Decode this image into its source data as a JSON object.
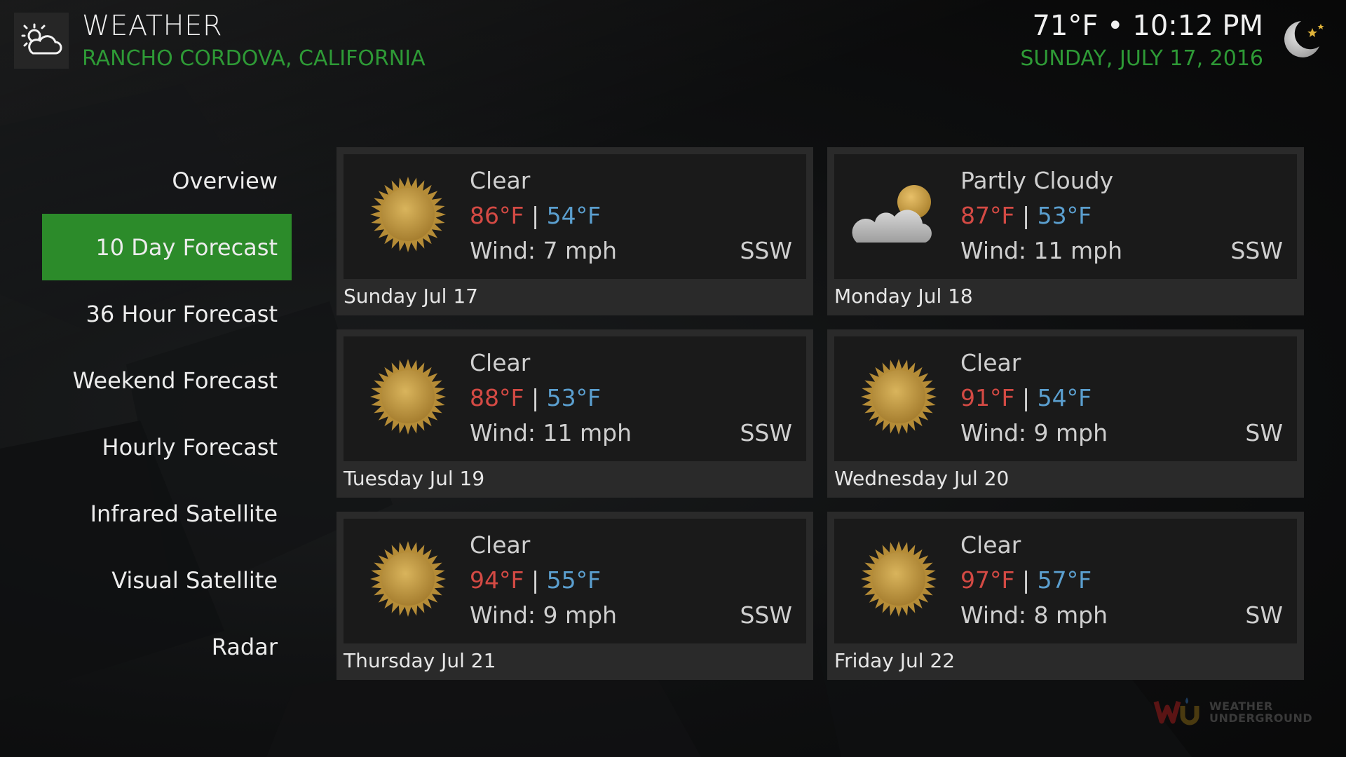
{
  "header": {
    "app_icon": "weather-app-icon",
    "title": "WEATHER",
    "location": "RANCHO CORDOVA, CALIFORNIA",
    "time_text": "71°F • 10:12 PM",
    "date_text": "SUNDAY, JULY 17, 2016",
    "condition_icon": "moon-stars-icon"
  },
  "sidebar": {
    "items": [
      {
        "label": "Overview",
        "active": false
      },
      {
        "label": "10 Day Forecast",
        "active": true
      },
      {
        "label": "36 Hour Forecast",
        "active": false
      },
      {
        "label": "Weekend Forecast",
        "active": false
      },
      {
        "label": "Hourly Forecast",
        "active": false
      },
      {
        "label": "Infrared Satellite",
        "active": false
      },
      {
        "label": "Visual Satellite",
        "active": false
      },
      {
        "label": "Radar",
        "active": false
      }
    ]
  },
  "forecast": [
    {
      "icon": "sun-icon",
      "condition": "Clear",
      "high": "86°F",
      "sep": "|",
      "low": "54°F",
      "wind": "Wind: 7 mph",
      "direction": "SSW",
      "day": "Sunday Jul 17"
    },
    {
      "icon": "partly-cloudy-icon",
      "condition": "Partly Cloudy",
      "high": "87°F",
      "sep": "|",
      "low": "53°F",
      "wind": "Wind: 11 mph",
      "direction": "SSW",
      "day": "Monday Jul 18"
    },
    {
      "icon": "sun-icon",
      "condition": "Clear",
      "high": "88°F",
      "sep": "|",
      "low": "53°F",
      "wind": "Wind: 11 mph",
      "direction": "SSW",
      "day": "Tuesday Jul 19"
    },
    {
      "icon": "sun-icon",
      "condition": "Clear",
      "high": "91°F",
      "sep": "|",
      "low": "54°F",
      "wind": "Wind: 9 mph",
      "direction": "SW",
      "day": "Wednesday Jul 20"
    },
    {
      "icon": "sun-icon",
      "condition": "Clear",
      "high": "94°F",
      "sep": "|",
      "low": "55°F",
      "wind": "Wind: 9 mph",
      "direction": "SSW",
      "day": "Thursday Jul 21"
    },
    {
      "icon": "sun-icon",
      "condition": "Clear",
      "high": "97°F",
      "sep": "|",
      "low": "57°F",
      "wind": "Wind: 8 mph",
      "direction": "SW",
      "day": "Friday Jul 22"
    }
  ],
  "footer": {
    "logo_text": "WEATHER\nUNDERGROUND"
  },
  "colors": {
    "accent_green": "#2c8b2a",
    "location_green": "#2e9a36",
    "high_temp": "#d44a44",
    "low_temp": "#5b9fcf"
  }
}
